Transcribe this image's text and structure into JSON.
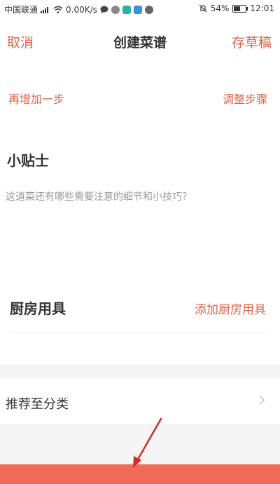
{
  "status_bar": {
    "carrier": "中国联通",
    "network_speed": "0.00K/s",
    "battery": "54%",
    "battery_level": 0.54,
    "time": "12:01",
    "icons": [
      "signal-icon",
      "wifi-icon",
      "chat-bubble-icon",
      "app-icon",
      "app-icon",
      "app-icon",
      "app-icon",
      "mute-icon",
      "battery-icon"
    ]
  },
  "nav": {
    "cancel_label": "取消",
    "title": "创建菜谱",
    "draft_label": "存草稿"
  },
  "steps": {
    "add_step_label": "再增加一步",
    "adjust_steps_label": "调整步骤"
  },
  "tips": {
    "heading": "小贴士",
    "placeholder": "这道菜还有哪些需要注意的细节和小技巧？",
    "value": ""
  },
  "kitchenware": {
    "heading": "厨房用具",
    "add_label": "添加厨房用具"
  },
  "category": {
    "label": "推荐至分类"
  },
  "colors": {
    "accent": "#d9654a",
    "publish_bar": "#f06a55",
    "annotation_arrow": "#d42a2a"
  }
}
